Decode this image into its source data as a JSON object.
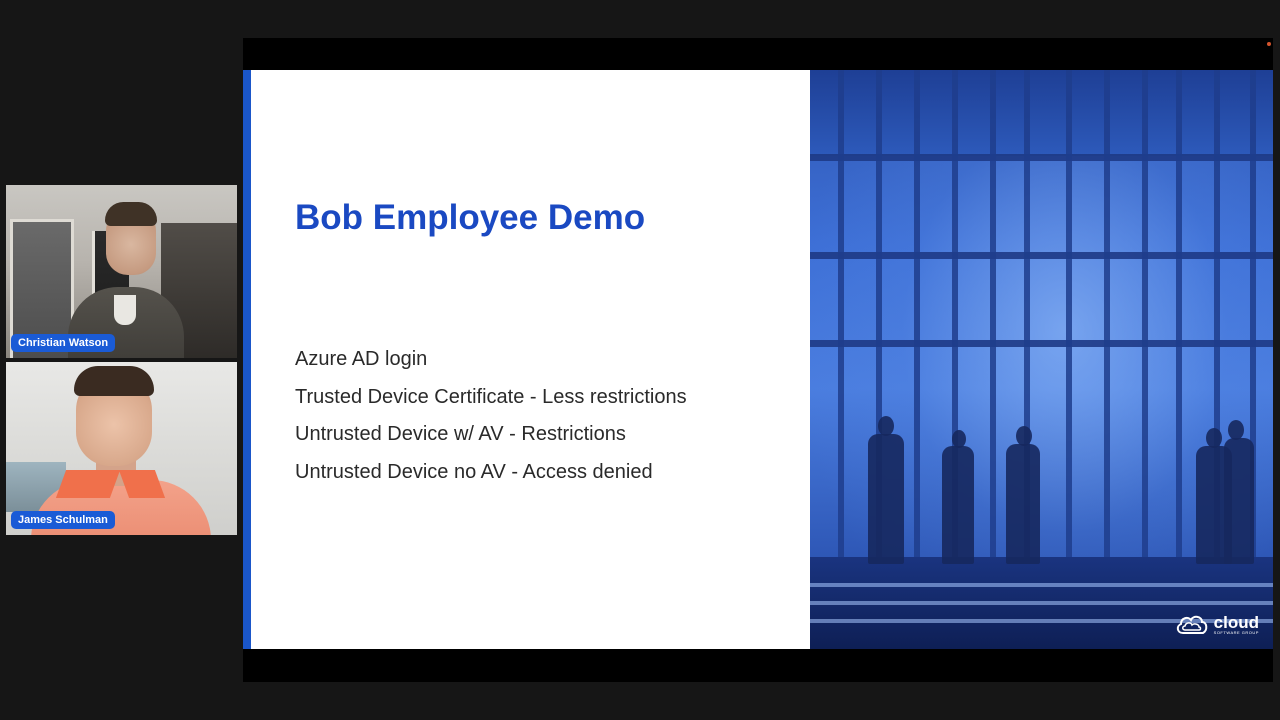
{
  "participants": [
    {
      "name": "Christian Watson"
    },
    {
      "name": "James Schulman"
    }
  ],
  "slide": {
    "title": "Bob Employee Demo",
    "bullets": [
      "Azure AD login",
      "Trusted Device Certificate - Less restrictions",
      "Untrusted Device w/ AV - Restrictions",
      "Untrusted Device no AV - Access denied"
    ],
    "logo": {
      "word": "cloud",
      "tagline": "SOFTWARE GROUP",
      "icon": "cloud-logo-icon"
    }
  },
  "colors": {
    "badge": "#1a5bd6",
    "title": "#1a49c2",
    "accent_bar": "#1a56c9",
    "recording_dot": "#d4542d"
  }
}
